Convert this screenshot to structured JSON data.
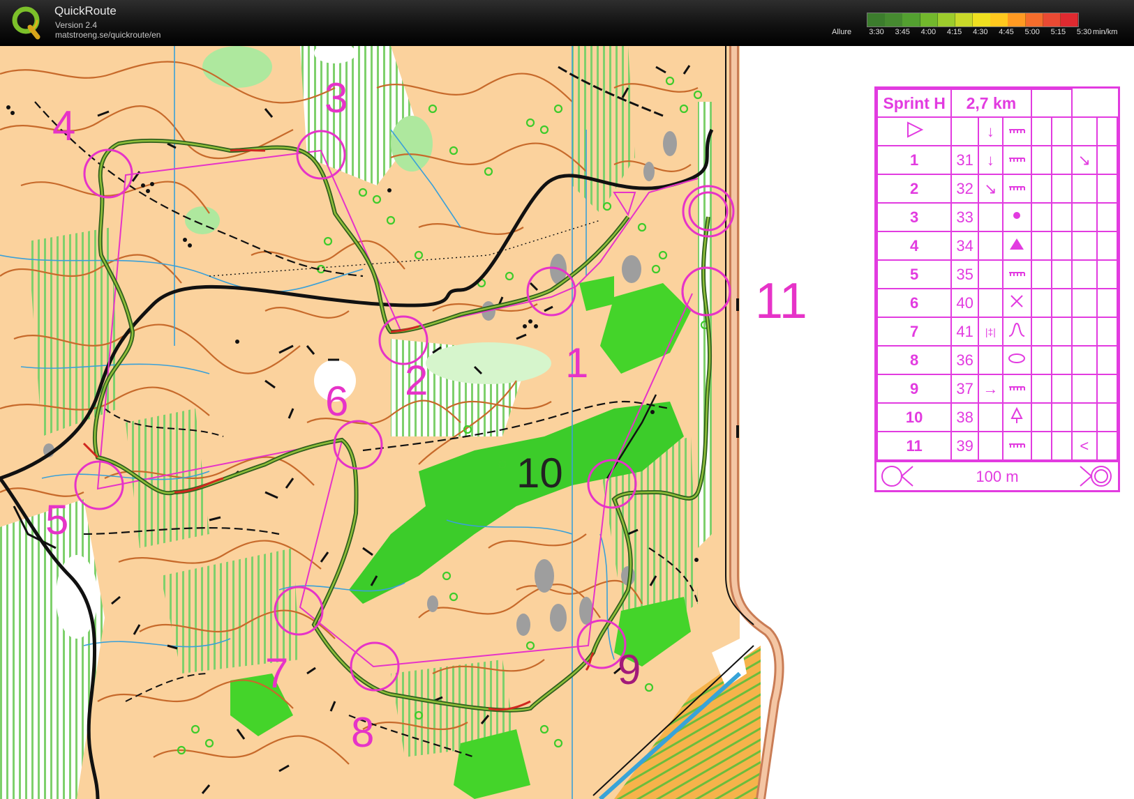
{
  "app": {
    "title": "QuickRoute",
    "version": "Version 2.4",
    "url": "matstroeng.se/quickroute/en"
  },
  "pace_scale": {
    "label": "Allure",
    "ticks": [
      "3:30",
      "3:45",
      "4:00",
      "4:15",
      "4:30",
      "4:45",
      "5:00",
      "5:15",
      "5:30"
    ],
    "unit": "min/km",
    "colors": [
      "#3c7d2d",
      "#468a30",
      "#53a030",
      "#72b82c",
      "#9ccc2c",
      "#c9d929",
      "#f0e020",
      "#ffc81e",
      "#ff9a22",
      "#f56d2c",
      "#ea4a33",
      "#df2a30"
    ]
  },
  "course": {
    "name": "Sprint H",
    "length": "2,7 km",
    "scale_text": "100 m",
    "control_labels": [
      "1",
      "2",
      "3",
      "4",
      "5",
      "6",
      "7",
      "8",
      "9",
      "10",
      "11"
    ],
    "descriptions": [
      {
        "num": "",
        "code": "",
        "dir": "",
        "feature": "",
        "start": true
      },
      {
        "num": "1",
        "code": "31",
        "dir": "↓",
        "feature": "marsh"
      },
      {
        "num": "2",
        "code": "32",
        "dir": "↘",
        "feature": "marsh"
      },
      {
        "num": "3",
        "code": "33",
        "dir": "",
        "feature": "dot"
      },
      {
        "num": "4",
        "code": "34",
        "dir": "",
        "feature": "triangle"
      },
      {
        "num": "5",
        "code": "35",
        "dir": "",
        "feature": "marsh"
      },
      {
        "num": "6",
        "code": "40",
        "dir": "",
        "feature": "cross"
      },
      {
        "num": "7",
        "code": "41",
        "dir": "|‡|",
        "feature": "spur"
      },
      {
        "num": "8",
        "code": "36",
        "dir": "",
        "feature": "oval"
      },
      {
        "num": "9",
        "code": "37",
        "dir": "→",
        "feature": "marsh"
      },
      {
        "num": "10",
        "code": "38",
        "dir": "",
        "feature": "tree"
      },
      {
        "num": "11",
        "code": "39",
        "dir": "",
        "feature": "marsh"
      }
    ]
  }
}
